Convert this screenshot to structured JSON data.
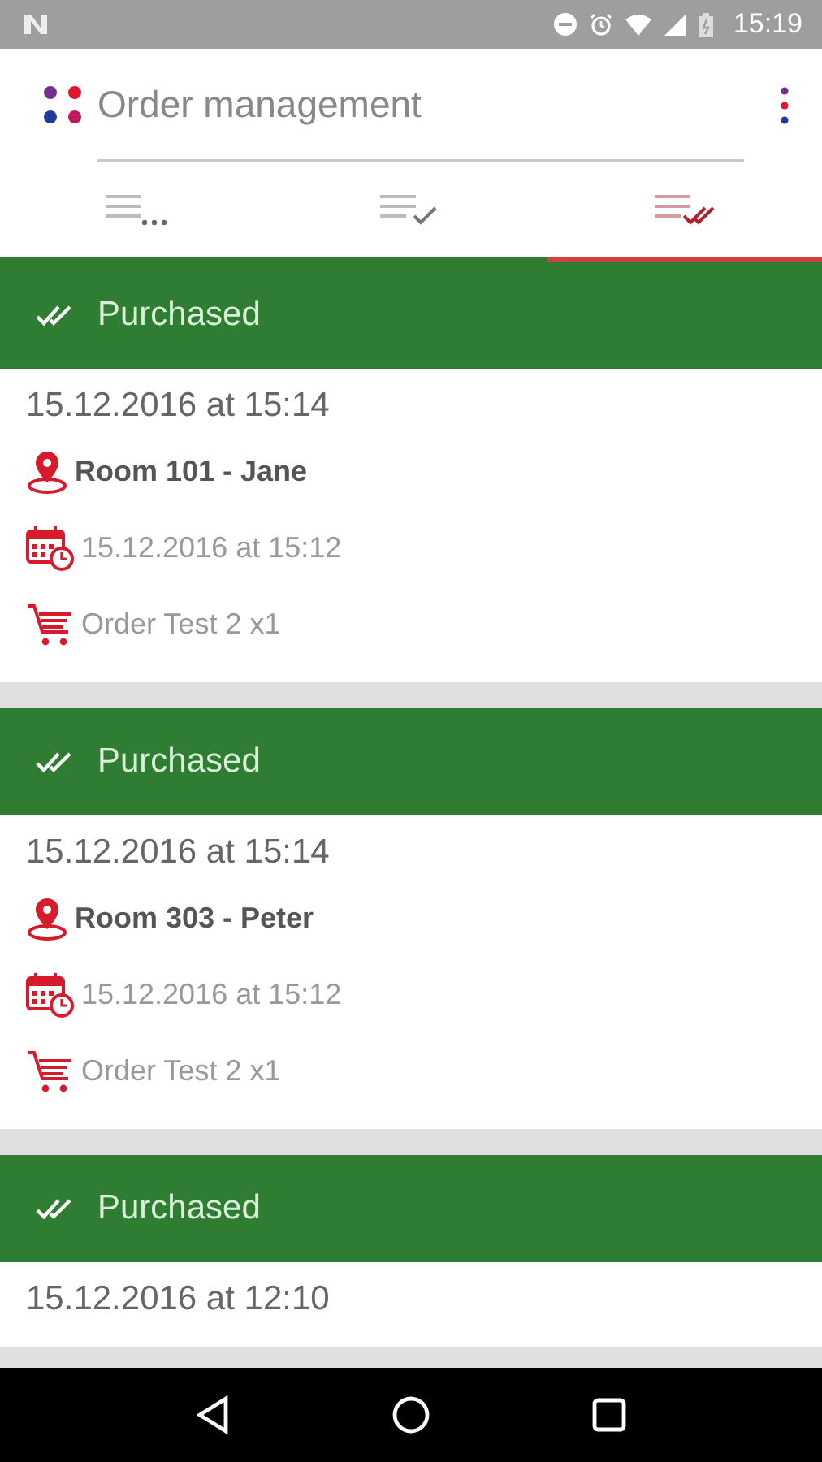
{
  "status_bar": {
    "time": "15:19"
  },
  "app_bar": {
    "title": "Order management"
  },
  "tabs": [
    {
      "kind": "pending",
      "selected": false
    },
    {
      "kind": "confirmed",
      "selected": false
    },
    {
      "kind": "purchased",
      "selected": true
    }
  ],
  "orders": [
    {
      "status": "Purchased",
      "created": "15.12.2016 at 15:14",
      "location": "Room 101 - Jane",
      "ordered": "15.12.2016 at 15:12",
      "items": "Order Test 2 x1"
    },
    {
      "status": "Purchased",
      "created": "15.12.2016 at 15:14",
      "location": "Room 303 - Peter",
      "ordered": "15.12.2016 at 15:12",
      "items": "Order Test 2 x1"
    },
    {
      "status": "Purchased",
      "created": "15.12.2016 at 12:10"
    }
  ]
}
